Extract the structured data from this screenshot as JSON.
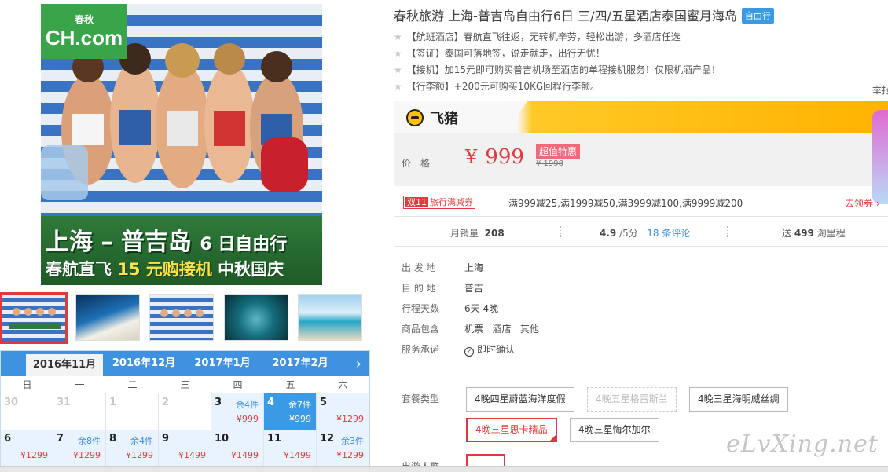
{
  "gallery": {
    "logo_text": "CH.com",
    "logo_sub": "春秋",
    "banner_title": "上海 – 普吉岛",
    "banner_title_sub": "6 日自由行",
    "banner_line2_a": "春航直飞 ",
    "banner_line2_b": "15 元购接机",
    "banner_line2_c": " 中秋国庆",
    "thumbs": [
      "thumb-1",
      "thumb-2",
      "thumb-3",
      "thumb-4",
      "thumb-5"
    ]
  },
  "calendar": {
    "months": [
      "2016年11月",
      "2016年12月",
      "2017年1月",
      "2017年2月"
    ],
    "next_glyph": "›",
    "weekdays": [
      "日",
      "一",
      "二",
      "三",
      "四",
      "五",
      "六"
    ],
    "rows": [
      [
        {
          "d": "30",
          "s": "",
          "p": "",
          "state": "past"
        },
        {
          "d": "31",
          "s": "",
          "p": "",
          "state": "past"
        },
        {
          "d": "1",
          "s": "",
          "p": "",
          "state": "past"
        },
        {
          "d": "2",
          "s": "",
          "p": "",
          "state": "past"
        },
        {
          "d": "3",
          "s": "余4件",
          "p": "¥999",
          "state": "avail"
        },
        {
          "d": "4",
          "s": "余7件",
          "p": "¥999",
          "state": "sel"
        },
        {
          "d": "5",
          "s": "",
          "p": "¥1299",
          "state": "avail"
        }
      ],
      [
        {
          "d": "6",
          "s": "",
          "p": "¥1299",
          "state": "avail"
        },
        {
          "d": "7",
          "s": "余8件",
          "p": "¥1299",
          "state": "avail"
        },
        {
          "d": "8",
          "s": "余4件",
          "p": "¥1299",
          "state": "avail"
        },
        {
          "d": "9",
          "s": "",
          "p": "¥1499",
          "state": "avail"
        },
        {
          "d": "10",
          "s": "",
          "p": "¥1499",
          "state": "avail"
        },
        {
          "d": "11",
          "s": "",
          "p": "¥1499",
          "state": "avail"
        },
        {
          "d": "12",
          "s": "余3件",
          "p": "¥1299",
          "state": "avail"
        }
      ]
    ]
  },
  "product": {
    "title": "春秋旅游 上海-普吉岛自由行6日 三/四/五星酒店泰国蜜月海岛",
    "badge": "自由行",
    "features": [
      "【航班酒店】春航直飞往返，无转机辛劳，轻松出游；多酒店任选",
      "【签证】泰国可落地签，说走就走，出行无忧！",
      "【接机】加15元即可购买普吉机场至酒店的单程接机服务！仅限机酒产品！",
      "【行李额】+200元可购买10KG回程行李额。"
    ],
    "report": "举报",
    "fliggy_logo": "飞猪",
    "price_label": "价格",
    "currency": "¥",
    "price": "999",
    "deal_badge": "超值特惠",
    "original_price": "¥ 1998",
    "coupon_tag_a": "双11",
    "coupon_tag_b": "旅行满减券",
    "coupon_text": "满999减25,满1999减50,满3999减100,满9999减200",
    "coupon_link": "去领券 ›",
    "stats": {
      "sales_label": "月销量",
      "sales": "208",
      "rating": "4.9",
      "rating_unit": "/5分",
      "reviews": "18 条评论",
      "points_a": "送",
      "points": "499",
      "points_b": "淘里程"
    },
    "details": [
      {
        "label": "出 发 地",
        "value": "上海"
      },
      {
        "label": "目 的 地",
        "value": "普吉"
      },
      {
        "label": "行程天数",
        "value": "6天 4晚"
      },
      {
        "label": "商品包含",
        "value": "机票   酒店   其他"
      },
      {
        "label": "服务承诺",
        "value": "即时确认"
      }
    ],
    "package_label": "套餐类型",
    "packages": [
      "4晚四星蔚蓝海洋度假",
      "4晚五星格雷斯兰",
      "4晚三星海明威丝绸",
      "4晚三星思卡精品",
      "4晚三星悔尔加尔"
    ],
    "people_label": "出游人群"
  },
  "watermark": "eLvXing.net",
  "colors": {
    "accent_red": "#e4393c",
    "calendar_blue": "#3f92e0",
    "fliggy_yellow": "#ffc926"
  }
}
